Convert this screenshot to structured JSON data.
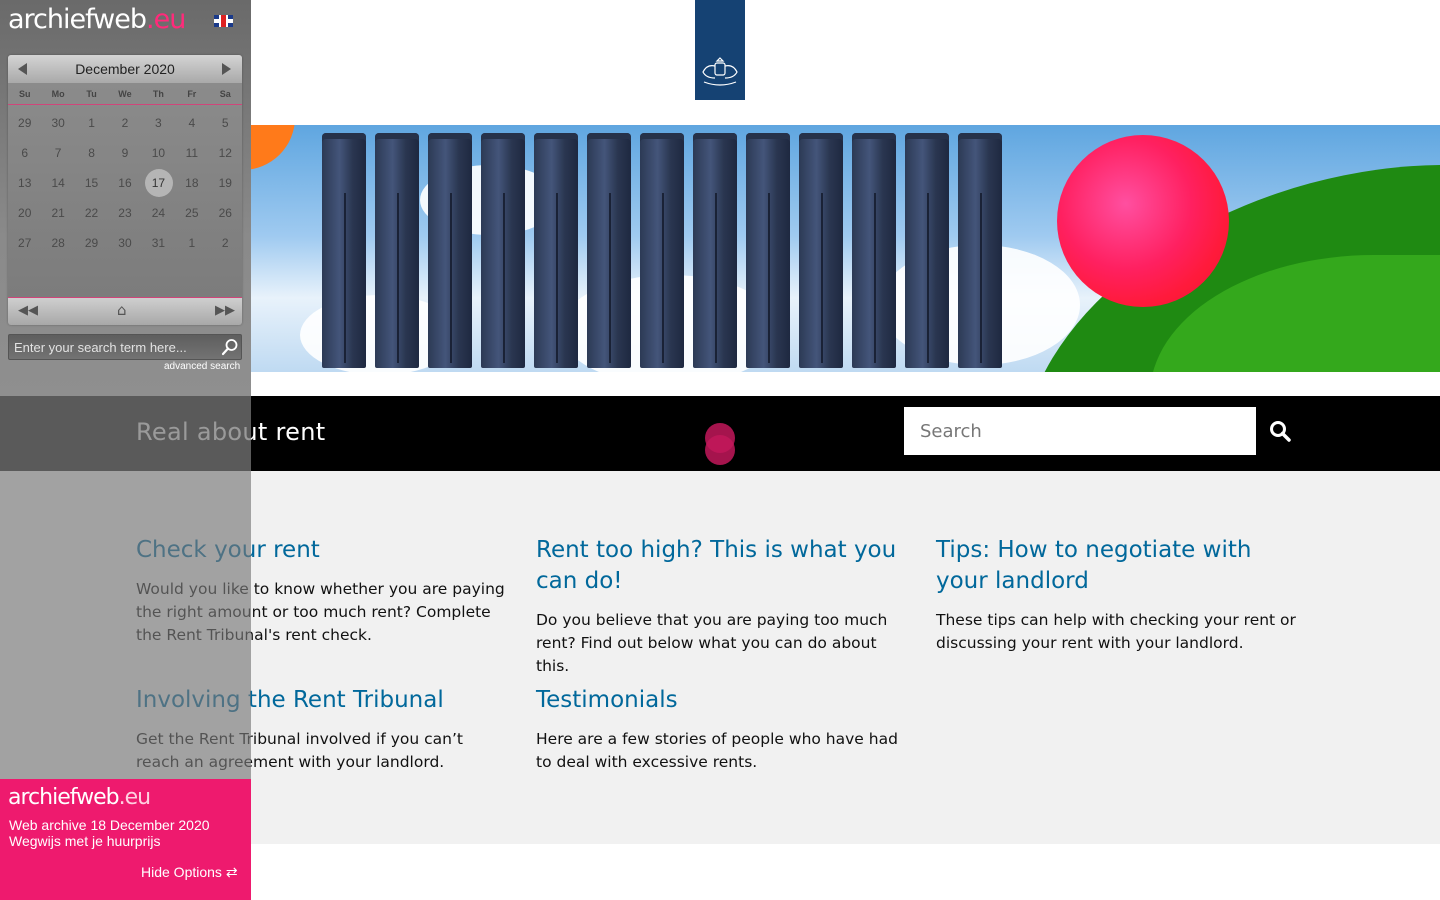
{
  "site": {
    "title": "Real about rent",
    "search_placeholder": "Search",
    "logo_alt": "Rijksoverheid",
    "colors": {
      "heading": "#01689b",
      "topbar": "#000000",
      "content_bg": "#f1f1f1",
      "logo_tile": "#154273"
    },
    "cards": [
      {
        "title": "Check your rent",
        "text": "Would you like to know whether you are paying the right amount or too much rent? Complete the Rent Tribunal's rent check."
      },
      {
        "title": "Rent too high? This is what you can do!",
        "text": "Do you believe that you are paying too much rent? Find out below what you can do about this."
      },
      {
        "title": "Tips: How to negotiate with your landlord",
        "text": "These tips can help with checking your rent or discussing your rent with your landlord."
      },
      {
        "title": "Involving the Rent Tribunal",
        "text": "Get the Rent Tribunal involved if you can’t reach an agreement with your landlord."
      },
      {
        "title": "Testimonials",
        "text": "Here are a few stories of people who have had to deal with excessive rents."
      }
    ]
  },
  "archive": {
    "brand_main": "archiefweb",
    "brand_ext": ".eu",
    "calendar": {
      "month": "December 2020",
      "weekdays": [
        "Su",
        "Mo",
        "Tu",
        "We",
        "Th",
        "Fr",
        "Sa"
      ],
      "weeks": [
        [
          "29",
          "30",
          "1",
          "2",
          "3",
          "4",
          "5"
        ],
        [
          "6",
          "7",
          "8",
          "9",
          "10",
          "11",
          "12"
        ],
        [
          "13",
          "14",
          "15",
          "16",
          "17",
          "18",
          "19"
        ],
        [
          "20",
          "21",
          "22",
          "23",
          "24",
          "25",
          "26"
        ],
        [
          "27",
          "28",
          "29",
          "30",
          "31",
          "1",
          "2"
        ]
      ],
      "selected_day": "17"
    },
    "search_placeholder": "Enter your search term here...",
    "advanced_search": "advanced search",
    "info_line1": "Web archive 18 December 2020",
    "info_line2": "Wegwijs met je huurprijs",
    "hide_options": "Hide Options ⇄",
    "colors": {
      "accent": "#ee1a6e"
    }
  }
}
